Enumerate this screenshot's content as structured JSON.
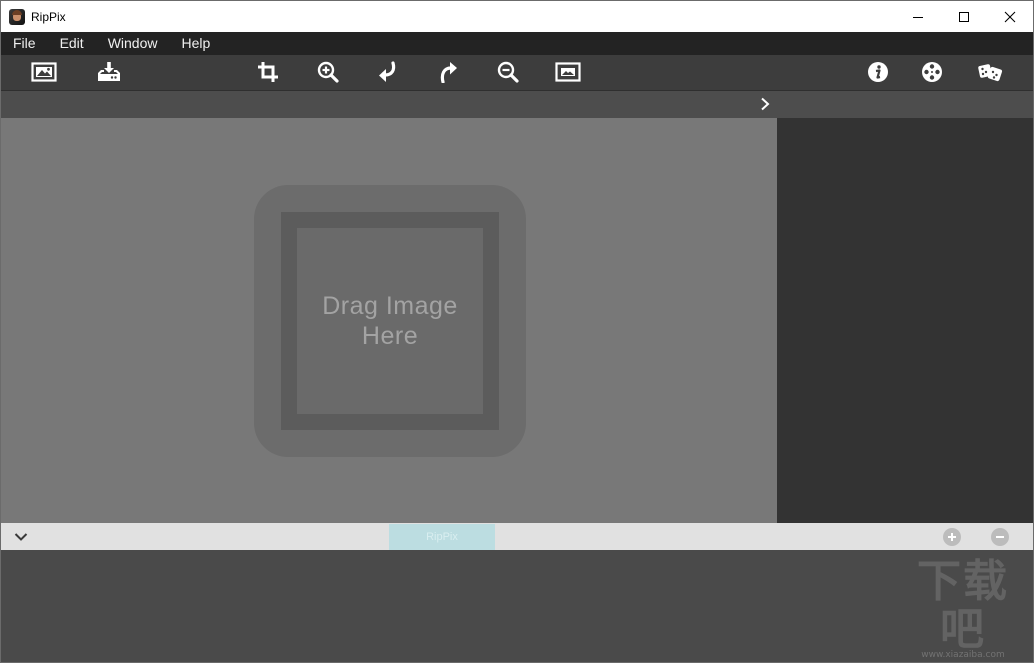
{
  "window": {
    "title": "RipPix",
    "minimize_icon": "minimize-icon",
    "maximize_icon": "maximize-icon",
    "close_icon": "close-icon"
  },
  "menu": {
    "items": [
      "File",
      "Edit",
      "Window",
      "Help"
    ]
  },
  "toolbar": {
    "buttons": [
      {
        "name": "open-image-button",
        "icon": "image-icon"
      },
      {
        "name": "save-button",
        "icon": "tray-download-icon"
      },
      {
        "name": "crop-button",
        "icon": "crop-icon"
      },
      {
        "name": "zoom-in-button",
        "icon": "zoom-in-icon"
      },
      {
        "name": "undo-button",
        "icon": "undo-arrow-icon"
      },
      {
        "name": "redo-button",
        "icon": "redo-arrow-icon"
      },
      {
        "name": "zoom-out-button",
        "icon": "zoom-out-icon"
      },
      {
        "name": "fit-image-button",
        "icon": "image-frame-icon"
      },
      {
        "name": "info-button",
        "icon": "info-icon"
      },
      {
        "name": "settings-button",
        "icon": "film-reel-icon"
      },
      {
        "name": "random-button",
        "icon": "dice-icon"
      }
    ]
  },
  "canvas": {
    "drop_text": "Drag Image\nHere"
  },
  "bottom": {
    "tab_label": "RipPix",
    "add_icon": "plus-circle-icon",
    "remove_icon": "minus-circle-icon"
  },
  "watermark": {
    "main": "下载吧",
    "sub": "www.xiazaiba.com"
  },
  "colors": {
    "toolbar": "#3d3d3d",
    "menubar": "#232323",
    "canvas": "#787878",
    "side_panel": "#333333",
    "tab_active": "#bcdde1"
  }
}
